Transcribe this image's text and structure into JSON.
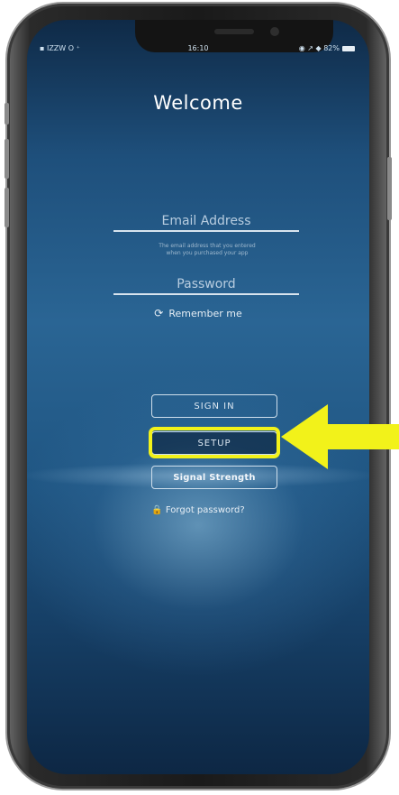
{
  "status_bar": {
    "carrier": "▪ IZZW O ⁺ ",
    "time": "16:10",
    "right": "◉ ↗ ◆ 82%"
  },
  "screen": {
    "title": "Welcome",
    "email_placeholder": "Email Address",
    "email_hint_line1": "The email address that you entered",
    "email_hint_line2": "when you purchased your app",
    "password_placeholder": "Password",
    "remember_label": "Remember me",
    "sign_in_label": "SIGN IN",
    "setup_label": "SETUP",
    "signal_label": "Signal Strength",
    "forgot_label": "Forgot password?"
  },
  "colors": {
    "highlight": "#f2f21a",
    "arrow": "#f2f21a"
  }
}
